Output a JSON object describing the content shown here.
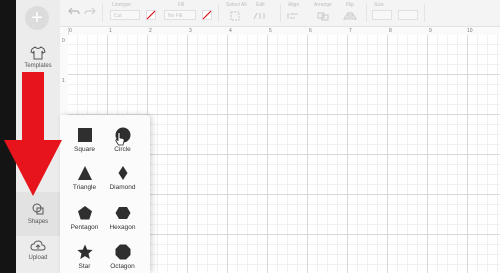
{
  "toolbar": {
    "labels": [
      "Linetype",
      "Fill",
      "Select All",
      "Edit",
      "Align",
      "Arrange",
      "Flip",
      "Size"
    ],
    "linetype_value": "Cut",
    "fill_value": "No Fill"
  },
  "ruler": {
    "top": [
      "0",
      "1",
      "2",
      "3",
      "4",
      "5",
      "6",
      "7",
      "8",
      "9",
      "10"
    ],
    "left": [
      "0",
      "1"
    ]
  },
  "sidebar": {
    "items": [
      {
        "label": "Templates",
        "icon": "shirt-icon"
      },
      {
        "label": "Shapes",
        "icon": "shapes-icon"
      },
      {
        "label": "Upload",
        "icon": "upload-cloud-icon"
      }
    ]
  },
  "shapes_panel": {
    "items": [
      {
        "label": "Square",
        "icon": "square-icon"
      },
      {
        "label": "Circle",
        "icon": "circle-icon"
      },
      {
        "label": "Triangle",
        "icon": "triangle-icon"
      },
      {
        "label": "Diamond",
        "icon": "diamond-icon"
      },
      {
        "label": "Pentagon",
        "icon": "pentagon-icon"
      },
      {
        "label": "Hexagon",
        "icon": "hexagon-icon"
      },
      {
        "label": "Star",
        "icon": "star-icon"
      },
      {
        "label": "Octagon",
        "icon": "octagon-icon"
      }
    ]
  },
  "colors": {
    "arrow": "#e8141b",
    "shape_fill": "#2f2f2f",
    "edge": "#141414"
  }
}
